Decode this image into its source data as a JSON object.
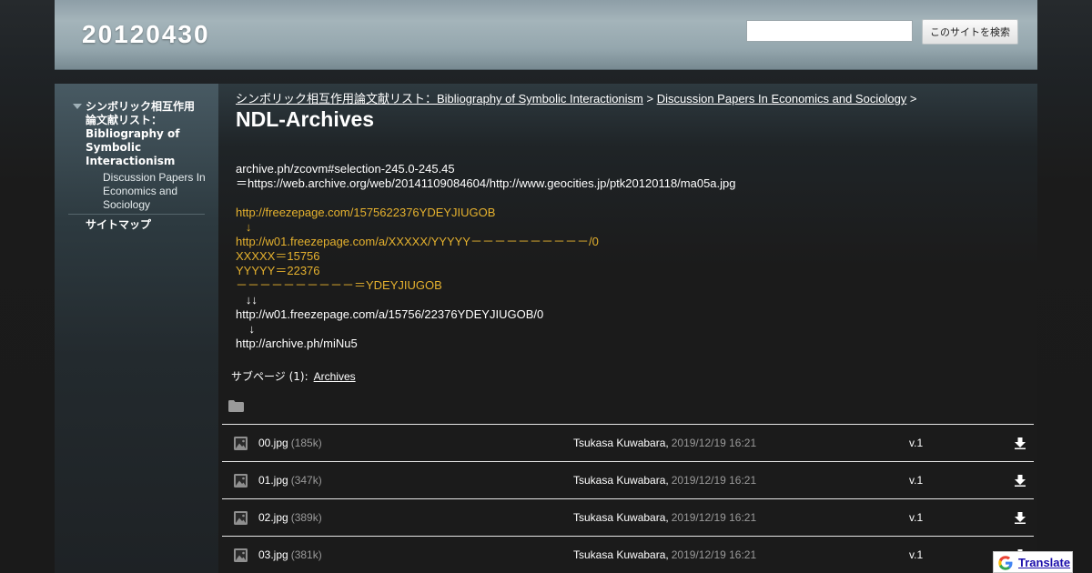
{
  "site": {
    "title": "20120430"
  },
  "search": {
    "value": "",
    "placeholder": "",
    "button_label": "このサイトを検索"
  },
  "sidebar": {
    "top_item": "シンボリック相互作用論文献リスト：Bibliography of Symbolic Interactionism",
    "sub_item": "Discussion Papers In Economics and Sociology",
    "sitemap": "サイトマップ"
  },
  "breadcrumb": {
    "crumb1": "シンボリック相互作用論文献リスト：Bibliography of Symbolic Interactionism",
    "sep1": " > ",
    "crumb2": "Discussion Papers In Economics and Sociology",
    "sep2": " >"
  },
  "page": {
    "title": "NDL-Archives"
  },
  "content": {
    "lines": [
      "archive.ph/zcovm#selection-245.0-245.45",
      "＝https://web.archive.org/web/20141109084604/http://www.geocities.jp/ptk20120118/ma05a.jpg",
      "",
      "http://freezepage.com/1575622376YDEYJIUGOB",
      "   ↓",
      "http://w01.freezepage.com/a/XXXXX/YYYYY－－－－－－－－－－/0",
      "XXXXX＝15756",
      "YYYYY＝22376",
      "－－－－－－－－－－＝YDEYJIUGOB",
      "   ↓↓",
      "http://w01.freezepage.com/a/15756/22376YDEYJIUGOB/0",
      "    ↓",
      "http://archive.ph/miNu5"
    ]
  },
  "subpages": {
    "label": "サブページ (1):",
    "link": "Archives"
  },
  "files": [
    {
      "name": "00.jpg",
      "size": "(185k)",
      "author": "Tsukasa Kuwabara,",
      "date": "2019/12/19 16:21",
      "version": "v.1"
    },
    {
      "name": "01.jpg",
      "size": "(347k)",
      "author": "Tsukasa Kuwabara,",
      "date": "2019/12/19 16:21",
      "version": "v.1"
    },
    {
      "name": "02.jpg",
      "size": "(389k)",
      "author": "Tsukasa Kuwabara,",
      "date": "2019/12/19 16:21",
      "version": "v.1"
    },
    {
      "name": "03.jpg",
      "size": "(381k)",
      "author": "Tsukasa Kuwabara,",
      "date": "2019/12/19 16:21",
      "version": "v.1"
    }
  ],
  "translate": {
    "label": "Translate"
  },
  "colors": {
    "link_gold": "#e5b12e",
    "header_bg": "#9aabb2",
    "page_bg": "#1b1b1b"
  }
}
